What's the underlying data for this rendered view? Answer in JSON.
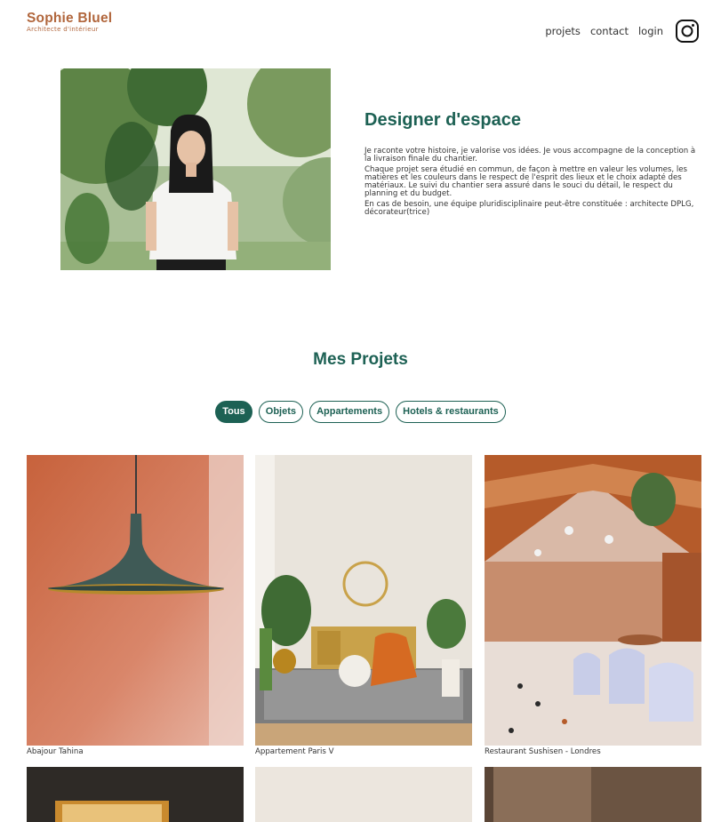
{
  "header": {
    "logo_name": "Sophie Bluel",
    "logo_subtitle": "Architecte d'intérieur",
    "nav": [
      "projets",
      "contact",
      "login"
    ]
  },
  "intro": {
    "title": "Designer d'espace",
    "paragraphs": [
      "Je raconte votre histoire, je valorise vos idées. Je vous accompagne de la conception à la livraison finale du chantier.",
      "Chaque projet sera étudié en commun, de façon à mettre en valeur les volumes, les matières et les couleurs dans le respect de l'esprit des lieux et le choix adapté des matériaux. Le suivi du chantier sera assuré dans le souci du détail, le respect du planning et du budget.",
      "En cas de besoin, une équipe pluridisciplinaire peut-être constituée : architecte DPLG, décorateur(trice)"
    ]
  },
  "projects": {
    "title": "Mes Projets",
    "filters": [
      "Tous",
      "Objets",
      "Appartements",
      "Hotels & restaurants"
    ],
    "active_filter": "Tous",
    "gallery": [
      {
        "caption": "Abajour Tahina"
      },
      {
        "caption": "Appartement Paris V"
      },
      {
        "caption": "Restaurant Sushisen - Londres"
      }
    ]
  },
  "colors": {
    "brand": "#B1663C",
    "accent": "#1D6154"
  }
}
